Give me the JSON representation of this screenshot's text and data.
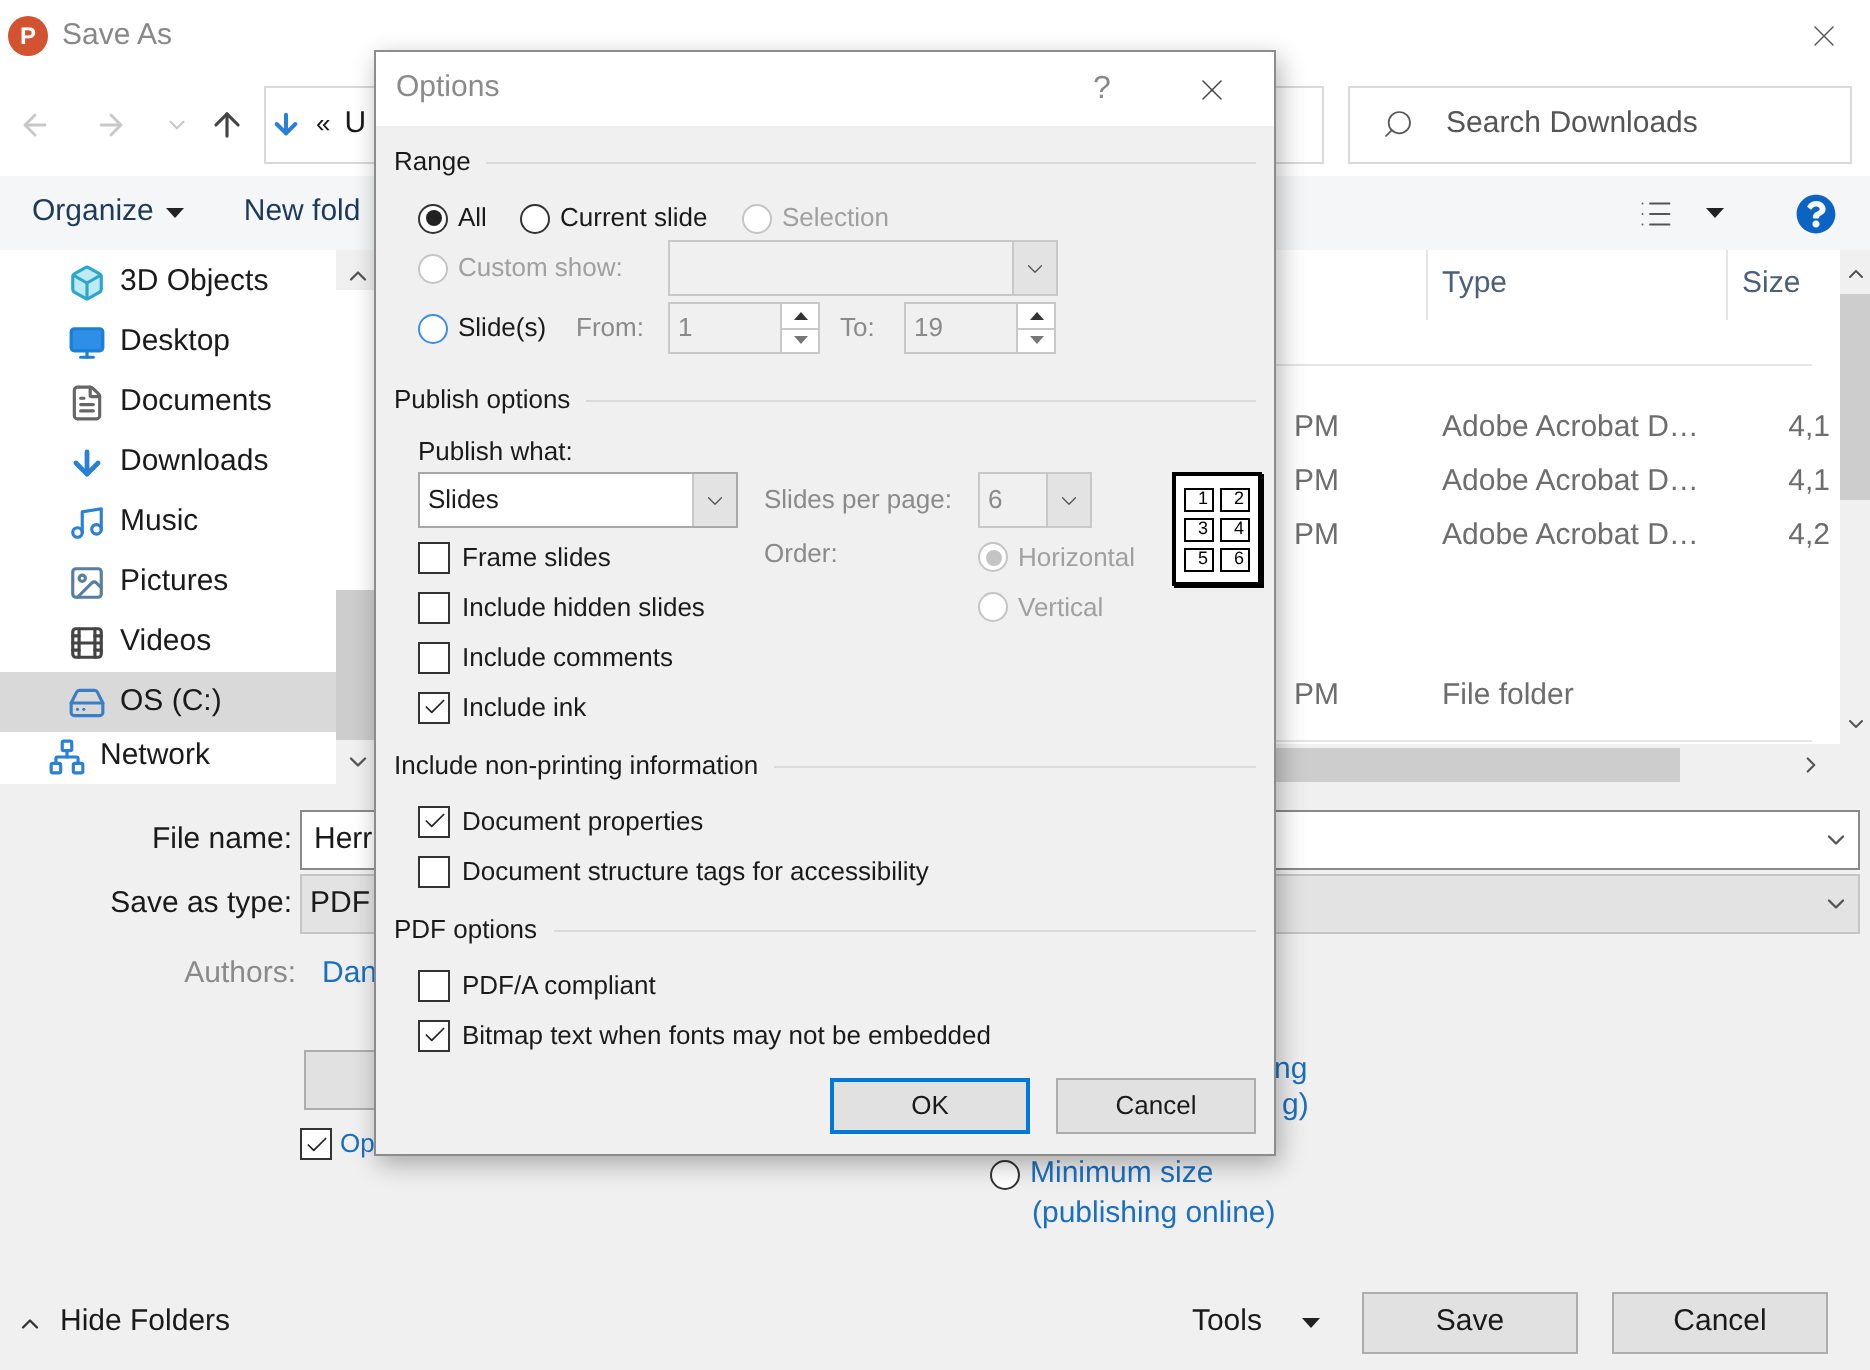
{
  "window": {
    "app_letter": "P",
    "title": "Save As"
  },
  "address": {
    "chevrons": "«",
    "path": "U"
  },
  "search": {
    "placeholder": "Search Downloads"
  },
  "toolbar": {
    "organize": "Organize",
    "new_folder": "New fold"
  },
  "sidebar": {
    "items": [
      {
        "label": "3D Objects",
        "selected": false
      },
      {
        "label": "Desktop",
        "selected": false
      },
      {
        "label": "Documents",
        "selected": false
      },
      {
        "label": "Downloads",
        "selected": false
      },
      {
        "label": "Music",
        "selected": false
      },
      {
        "label": "Pictures",
        "selected": false
      },
      {
        "label": "Videos",
        "selected": false
      },
      {
        "label": "OS (C:)",
        "selected": true
      },
      {
        "label": "Network",
        "selected": false
      }
    ]
  },
  "file_list": {
    "columns": [
      {
        "label": "Type"
      },
      {
        "label": "Size"
      }
    ],
    "rows": [
      {
        "modified": "PM",
        "type": "Adobe Acrobat D…",
        "size": "4,1"
      },
      {
        "modified": "PM",
        "type": "Adobe Acrobat D…",
        "size": "4,1"
      },
      {
        "modified": "PM",
        "type": "Adobe Acrobat D…",
        "size": "4,2"
      },
      {
        "modified": "PM",
        "type": "File folder"
      }
    ]
  },
  "form": {
    "file_name_label": "File name:",
    "file_name": "Herr",
    "type_label": "Save as type:",
    "type": "PDF",
    "authors_label": "Authors:",
    "authors": "Dan",
    "open_after": {
      "label": "Op",
      "checked": true
    },
    "covered_option_lines": [
      "ng",
      "g)"
    ],
    "minimum_size": {
      "lines": [
        "Minimum size",
        "(publishing online)"
      ],
      "selected": false
    }
  },
  "footer": {
    "hide_folders": "Hide Folders",
    "tools": "Tools",
    "save": "Save",
    "cancel": "Cancel"
  },
  "options_dialog": {
    "title": "Options",
    "help": "?",
    "range": {
      "heading": "Range",
      "choices": [
        {
          "label": "All",
          "selected": true,
          "disabled": false
        },
        {
          "label": "Current slide",
          "selected": false,
          "disabled": false
        },
        {
          "label": "Selection",
          "selected": false,
          "disabled": true
        }
      ],
      "custom_show": {
        "label": "Custom show:",
        "selected": false,
        "disabled": true
      },
      "slides": {
        "label": "Slide(s)",
        "selected": false,
        "from_label": "From:",
        "from": "1",
        "to_label": "To:",
        "to": "19"
      }
    },
    "publish": {
      "heading": "Publish options",
      "what_label": "Publish what:",
      "what": "Slides",
      "per_page_label": "Slides per page:",
      "per_page": "6",
      "order_label": "Order:",
      "orders": [
        {
          "label": "Horizontal",
          "selected": true,
          "disabled": true
        },
        {
          "label": "Vertical",
          "selected": false,
          "disabled": true
        }
      ],
      "layout_numbers": [
        "1",
        "2",
        "3",
        "4",
        "5",
        "6"
      ],
      "checks": [
        {
          "label": "Frame slides",
          "checked": false
        },
        {
          "label": "Include hidden slides",
          "checked": false
        },
        {
          "label": "Include comments",
          "checked": false
        },
        {
          "label": "Include ink",
          "checked": true
        }
      ]
    },
    "non_printing": {
      "heading": "Include non-printing information",
      "checks": [
        {
          "label": "Document properties",
          "checked": true
        },
        {
          "label": "Document structure tags for accessibility",
          "checked": false
        }
      ]
    },
    "pdf": {
      "heading": "PDF options",
      "checks": [
        {
          "label": "PDF/A compliant",
          "checked": false
        },
        {
          "label": "Bitmap text when fonts may not be embedded",
          "checked": true
        }
      ]
    },
    "buttons": [
      {
        "label": "OK",
        "default": true
      },
      {
        "label": "Cancel",
        "default": false
      }
    ]
  }
}
